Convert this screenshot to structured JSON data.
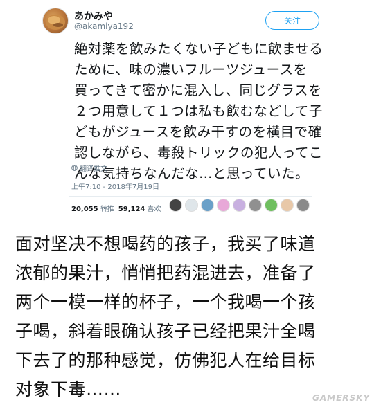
{
  "tweet": {
    "display_name": "あかみや",
    "handle": "@akamiya192",
    "follow_label": "关注",
    "text_lines": [
      "絶対薬を飲みたくない子どもに飲ませる",
      "ために、味の濃いフルーツジュースを",
      "買ってきて密かに混入し、同じグラスを",
      "２つ用意して１つは私も飲むなどして子",
      "どもがジュースを飲み干すのを横目で確",
      "認しながら、毒殺トリックの犯人ってこ",
      "んな気持ちなんだな…と思っていた。"
    ],
    "translate_label": "翻译推文",
    "timestamp": "上午7:10 - 2018年7月19日",
    "retweets_count": "20,055",
    "retweets_label": "转推",
    "likes_count": "59,124",
    "likes_label": "喜欢",
    "liker_avatar_colors": [
      "#444444",
      "#dfe6ea",
      "#6aa0c8",
      "#e8a8d8",
      "#c8b0e0",
      "#909090",
      "#6fbf5f",
      "#e8c8a8",
      "#8a8a8a"
    ]
  },
  "caption": {
    "lines": [
      "面对坚决不想喝药的孩子，我买了味道",
      "浓郁的果汁，悄悄把药混进去，准备了",
      "两个一模一样的杯子，一个我喝一个孩",
      "子喝，斜着眼确认孩子已经把果汁全喝",
      "下去了的那种感觉，仿佛犯人在给目标",
      "对象下毒……"
    ]
  },
  "watermark": "GAMERSKY"
}
